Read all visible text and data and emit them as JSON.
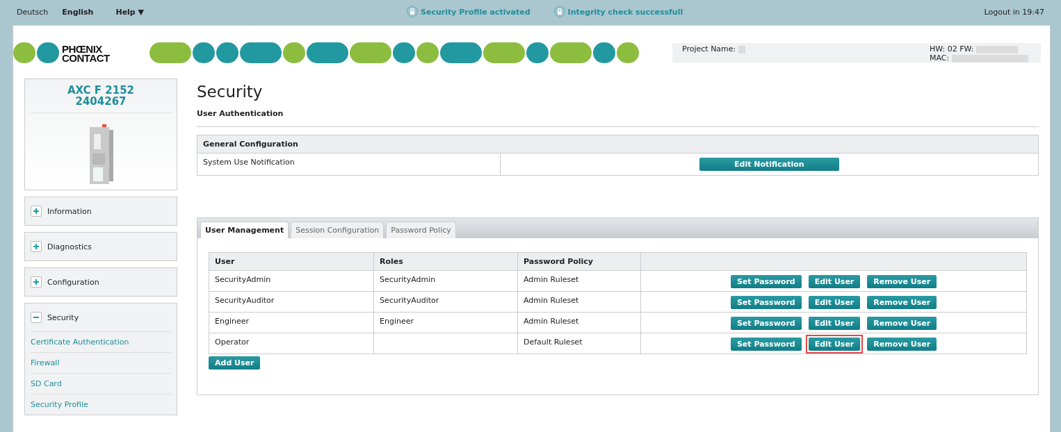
{
  "top_bar": {
    "languages": [
      {
        "label": "Deutsch",
        "selected": false
      },
      {
        "label": "English",
        "selected": true
      }
    ],
    "help": "Help ▼",
    "status": [
      "Security Profile activated",
      "Integrity check successfull"
    ],
    "logout": "Logout in 19:47"
  },
  "header": {
    "logo": [
      "PHŒNIX",
      "CONTACT"
    ],
    "project_label": "Project Name:",
    "hw_label": "HW: 02 FW:",
    "mac_label": "MAC:"
  },
  "device": {
    "name": "AXC F 2152",
    "number": "2404267"
  },
  "sidebar": {
    "sections": [
      {
        "label": "Information",
        "expanded": false
      },
      {
        "label": "Diagnostics",
        "expanded": false
      },
      {
        "label": "Configuration",
        "expanded": false
      },
      {
        "label": "Security",
        "expanded": true,
        "children": [
          {
            "label": "Certificate Authentication"
          },
          {
            "label": "Firewall"
          },
          {
            "label": "SD Card"
          },
          {
            "label": "Security Profile"
          }
        ]
      }
    ]
  },
  "page": {
    "title": "Security",
    "subtitle": "User Authentication",
    "general": {
      "heading": "General Configuration",
      "row_label": "System Use Notification",
      "button": "Edit Notification"
    },
    "tabs": [
      {
        "label": "User Management",
        "selected": true
      },
      {
        "label": "Session Configuration",
        "selected": false
      },
      {
        "label": "Password Policy",
        "selected": false
      }
    ],
    "table": {
      "columns": [
        "User",
        "Roles",
        "Password Policy"
      ],
      "rows": [
        {
          "user": "SecurityAdmin",
          "roles": "SecurityAdmin",
          "policy": "Admin Ruleset",
          "actions": [
            "Set Password",
            "Edit User",
            "Remove User"
          ],
          "highlighted": false
        },
        {
          "user": "SecurityAuditor",
          "roles": "SecurityAuditor",
          "policy": "Admin Ruleset",
          "actions": [
            "Set Password",
            "Edit User",
            "Remove User"
          ],
          "highlighted": false
        },
        {
          "user": "Engineer",
          "roles": "Engineer",
          "policy": "Admin Ruleset",
          "actions": [
            "Set Password",
            "Edit User",
            "Remove User"
          ],
          "highlighted": false
        },
        {
          "user": "Operator",
          "roles": "",
          "policy": "Default Ruleset",
          "actions": [
            "Set Password",
            "Edit User",
            "Remove User"
          ],
          "highlighted": true
        }
      ]
    },
    "add_button": "Add User"
  }
}
